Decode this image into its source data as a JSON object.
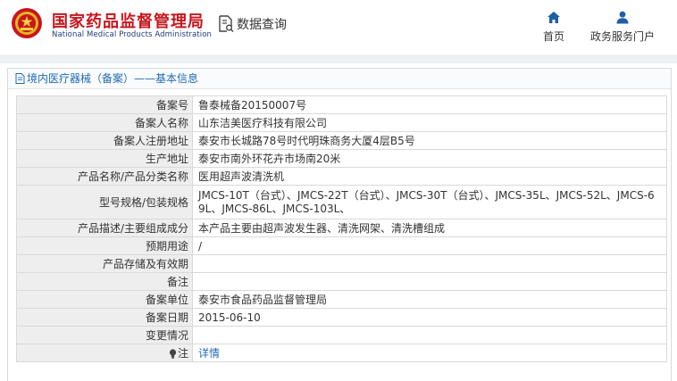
{
  "header": {
    "brand_cn": "国家药品监督管理局",
    "brand_en": "National Medical Products Administration",
    "search_label": "数据查询",
    "nav": [
      {
        "label": "首页",
        "icon": "home-icon"
      },
      {
        "label": "政务服务门户",
        "icon": "user-icon"
      }
    ]
  },
  "panel": {
    "title": "境内医疗器械（备案）——基本信息"
  },
  "rows": [
    {
      "key": "备案号",
      "value": "鲁泰械备20150007号"
    },
    {
      "key": "备案人名称",
      "value": "山东洁美医疗科技有限公司"
    },
    {
      "key": "备案人注册地址",
      "value": "泰安市长城路78号时代明珠商务大厦4层B5号"
    },
    {
      "key": "生产地址",
      "value": "泰安市南外环花卉市场南20米"
    },
    {
      "key": "产品名称/产品分类名称",
      "value": "医用超声波清洗机"
    },
    {
      "key": "型号规格/包装规格",
      "value": "JMCS-10T（台式）、JMCS-22T（台式）、JMCS-30T（台式）、JMCS-35L、JMCS-52L、JMCS-69L、JMCS-86L、JMCS-103L、"
    },
    {
      "key": "产品描述/主要组成成分",
      "value": "本产品主要由超声波发生器、清洗网架、清洗槽组成"
    },
    {
      "key": "预期用途",
      "value": "/"
    },
    {
      "key": "产品存储及有效期",
      "value": ""
    },
    {
      "key": "备注",
      "value": ""
    },
    {
      "key": "备案单位",
      "value": "泰安市食品药品监督管理局"
    },
    {
      "key": "备案日期",
      "value": "2015-06-10"
    },
    {
      "key": "变更情况",
      "value": ""
    },
    {
      "key": "注",
      "value": "详情"
    }
  ],
  "colors": {
    "brand_red": "#c8161e",
    "brand_blue": "#1f3b79",
    "link_blue": "#1f6bb3",
    "key_bg": "#eeeeee"
  }
}
